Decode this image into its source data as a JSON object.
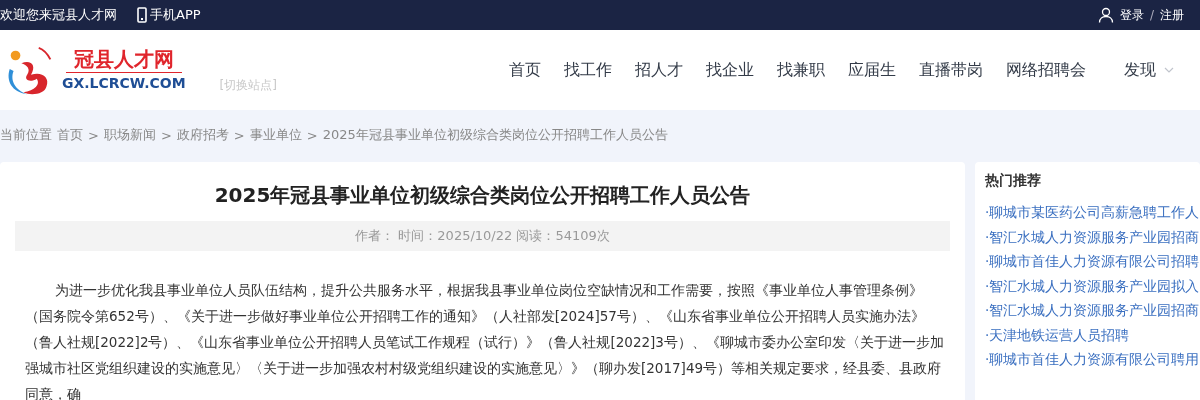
{
  "top_bar": {
    "welcome": "欢迎您来冠县人才网",
    "app_link": "手机APP",
    "login": "登录",
    "separator": "/",
    "register": "注册"
  },
  "logo": {
    "name": "冠县人才网",
    "domain": "GX.LCRCW.COM"
  },
  "switch_site": "[切换站点]",
  "nav": [
    {
      "label": "首页",
      "dropdown": false
    },
    {
      "label": "找工作",
      "dropdown": false
    },
    {
      "label": "招人才",
      "dropdown": false
    },
    {
      "label": "找企业",
      "dropdown": false
    },
    {
      "label": "找兼职",
      "dropdown": false
    },
    {
      "label": "应届生",
      "dropdown": false
    },
    {
      "label": "直播带岗",
      "dropdown": false
    },
    {
      "label": "网络招聘会",
      "dropdown": false
    },
    {
      "label": "发现",
      "dropdown": true
    }
  ],
  "breadcrumb": {
    "prefix": "当前位置",
    "separator": ">",
    "items": [
      "首页",
      "职场新闻",
      "政府招考",
      "事业单位",
      "2025年冠县事业单位初级综合类岗位公开招聘工作人员公告"
    ]
  },
  "article": {
    "title": "2025年冠县事业单位初级综合类岗位公开招聘工作人员公告",
    "meta": "作者：  时间：2025/10/22 阅读：54109次",
    "body": "为进一步优化我县事业单位人员队伍结构，提升公共服务水平，根据我县事业单位岗位空缺情况和工作需要，按照《事业单位人事管理条例》（国务院令第652号）、《关于进一步做好事业单位公开招聘工作的通知》（人社部发[2024]57号）、《山东省事业单位公开招聘人员实施办法》（鲁人社规[2022]2号）、《山东省事业单位公开招聘人员笔试工作规程（试行）》（鲁人社规[2022]3号）、《聊城市委办公室印发〈关于进一步加强城市社区党组织建设的实施意见〉〈关于进一步加强农村村级党组织建设的实施意见〉》（聊办发[2017]49号）等相关规定要求，经县委、县政府同意，确"
  },
  "sidebar": {
    "title": "热门推荐",
    "items": [
      "·聊城市某医药公司高薪急聘工作人",
      "·智汇水城人力资源服务产业园招商",
      "·聊城市首佳人力资源有限公司招聘",
      "·智汇水城人力资源服务产业园拟入",
      "·智汇水城人力资源服务产业园招商",
      "·天津地铁运营人员招聘",
      "·聊城市首佳人力资源有限公司聘用"
    ]
  }
}
